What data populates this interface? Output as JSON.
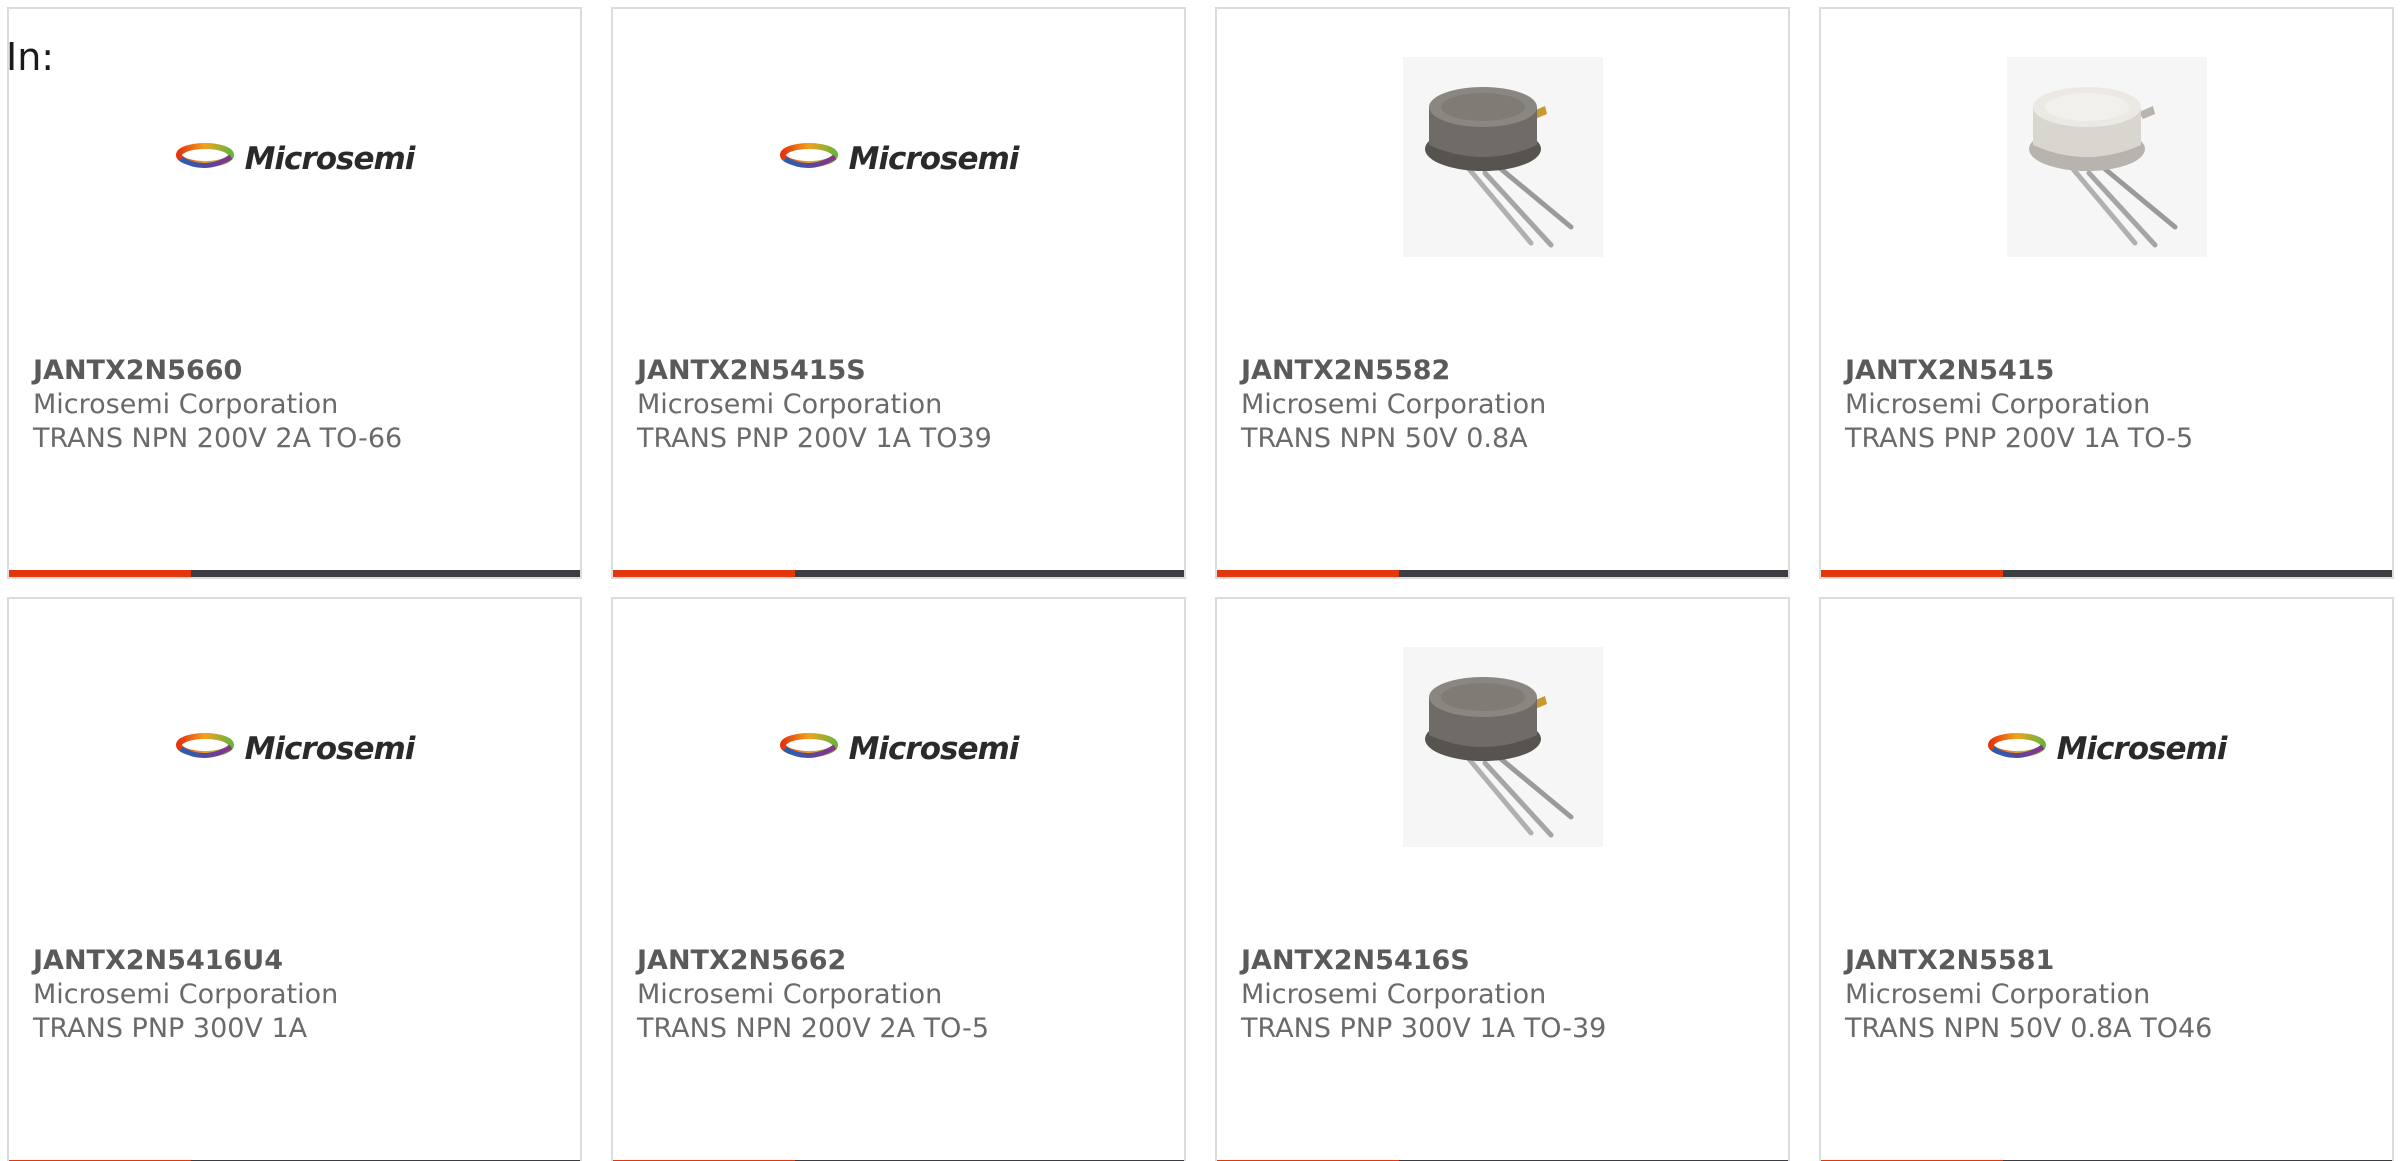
{
  "header": {
    "in_label": "In:"
  },
  "brand": {
    "logo_text": "Microsemi",
    "accent_color": "#e2360d",
    "bar_color": "#3c3d40"
  },
  "products": [
    {
      "part": "JANTX2N5660",
      "manufacturer": "Microsemi Corporation",
      "description": "TRANS NPN 200V 2A TO-66",
      "image": "microsemi-logo"
    },
    {
      "part": "JANTX2N5415S",
      "manufacturer": "Microsemi Corporation",
      "description": "TRANS PNP 200V 1A TO39",
      "image": "microsemi-logo"
    },
    {
      "part": "JANTX2N5582",
      "manufacturer": "Microsemi Corporation",
      "description": "TRANS NPN 50V 0.8A",
      "image": "transistor-can-dark"
    },
    {
      "part": "JANTX2N5415",
      "manufacturer": "Microsemi Corporation",
      "description": "TRANS PNP 200V 1A TO-5",
      "image": "transistor-can-light"
    },
    {
      "part": "JANTX2N5416U4",
      "manufacturer": "Microsemi Corporation",
      "description": "TRANS PNP 300V 1A",
      "image": "microsemi-logo"
    },
    {
      "part": "JANTX2N5662",
      "manufacturer": "Microsemi Corporation",
      "description": "TRANS NPN 200V 2A TO-5",
      "image": "microsemi-logo"
    },
    {
      "part": "JANTX2N5416S",
      "manufacturer": "Microsemi Corporation",
      "description": "TRANS PNP 300V 1A TO-39",
      "image": "transistor-can-dark"
    },
    {
      "part": "JANTX2N5581",
      "manufacturer": "Microsemi Corporation",
      "description": "TRANS NPN 50V 0.8A TO46",
      "image": "microsemi-logo"
    }
  ]
}
